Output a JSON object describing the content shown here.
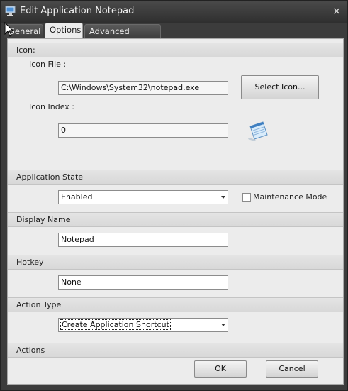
{
  "window": {
    "title": "Edit Application Notepad",
    "close_glyph": "×"
  },
  "tabs": [
    {
      "label": "General",
      "active": false
    },
    {
      "label": "Options",
      "active": true
    },
    {
      "label": "Advanced Settings",
      "active": false
    }
  ],
  "icon_section": {
    "header": "Icon:",
    "icon_file_label": "Icon File :",
    "icon_file_value": "C:\\Windows\\System32\\notepad.exe",
    "select_icon_button": "Select Icon...",
    "icon_index_label": "Icon Index :",
    "icon_index_value": "0",
    "preview_icon": "notepad-icon"
  },
  "application_state": {
    "header": "Application State",
    "selected": "Enabled",
    "maintenance_label": "Maintenance Mode",
    "maintenance_checked": false
  },
  "display_name": {
    "header": "Display Name",
    "value": "Notepad"
  },
  "hotkey": {
    "header": "Hotkey",
    "value": "None"
  },
  "action_type": {
    "header": "Action Type",
    "selected": "Create Application Shortcut"
  },
  "actions": {
    "header": "Actions",
    "ok_label": "OK",
    "cancel_label": "Cancel"
  }
}
